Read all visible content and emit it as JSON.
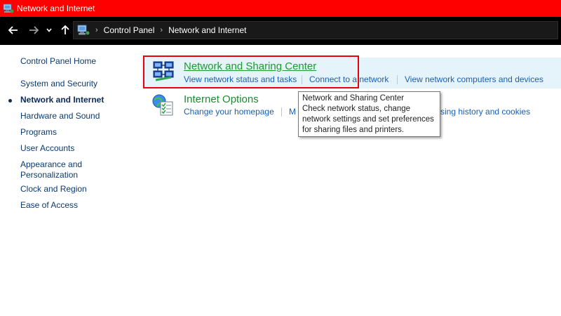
{
  "window": {
    "title": "Network and Internet",
    "icon": "control-panel-icon"
  },
  "nav": {
    "back_icon": "arrow-left-icon",
    "forward_icon": "arrow-right-icon",
    "recent_icon": "chevron-down-icon",
    "up_icon": "arrow-up-icon"
  },
  "address": {
    "icon": "control-panel-icon",
    "crumbs": [
      "Control Panel",
      "Network and Internet"
    ],
    "separator": "›"
  },
  "sidebar": {
    "home": "Control Panel Home",
    "items": [
      {
        "label": "System and Security",
        "current": false
      },
      {
        "label": "Network and Internet",
        "current": true
      },
      {
        "label": "Hardware and Sound",
        "current": false
      },
      {
        "label": "Programs",
        "current": false
      },
      {
        "label": "User Accounts",
        "current": false
      },
      {
        "label": "Appearance and",
        "label2": "Personalization",
        "current": false
      },
      {
        "label": "Clock and Region",
        "current": false
      },
      {
        "label": "Ease of Access",
        "current": false
      }
    ]
  },
  "categories": [
    {
      "title": "Network and Sharing Center",
      "icon": "network-sharing-icon",
      "tasks": [
        "View network status and tasks",
        "Connect to a network",
        "View network computers and devices"
      ]
    },
    {
      "title": "Internet Options",
      "icon": "internet-options-icon",
      "tasks": [
        "Change your homepage",
        "M",
        "sing history and cookies"
      ]
    }
  ],
  "tooltip": {
    "lines": [
      "Network and Sharing Center",
      "Check network status, change",
      "network settings and set preferences",
      "for sharing files and printers."
    ]
  },
  "colors": {
    "titlebar": "#ff0000",
    "navbar": "#000000",
    "link": "#1a5fb4",
    "category_title": "#1e8a32",
    "highlight_box": "#e8000b",
    "hover_band": "#e5f3fb"
  }
}
